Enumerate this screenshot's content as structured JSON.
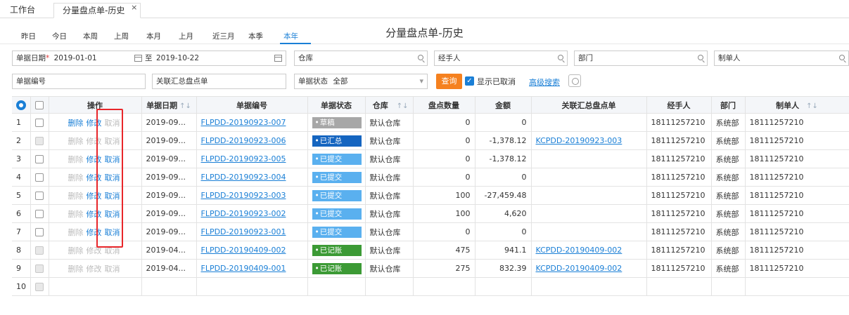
{
  "tabs": {
    "home": "工作台",
    "active": "分量盘点单-历史",
    "close": "×"
  },
  "page_title": "分量盘点单-历史",
  "periods": [
    "昨日",
    "今日",
    "本周",
    "上周",
    "本月",
    "上月",
    "近三月",
    "本季",
    "本年"
  ],
  "active_period": "本年",
  "filters": {
    "date_label": "单据日期",
    "date_required": "*",
    "date_from": "2019-01-01",
    "date_sep": "至",
    "date_to": "2019-10-22",
    "warehouse": "仓库",
    "handler": "经手人",
    "dept": "部门",
    "creator": "制单人",
    "doc_no": "单据编号",
    "linked": "关联汇总盘点单",
    "status_label": "单据状态",
    "status_value": "全部",
    "dropdown_arrow": "▾",
    "query": "查询",
    "show_cancelled": "显示已取消",
    "show_cancelled_check": "✓",
    "advanced": "高级搜索"
  },
  "table": {
    "headers": {
      "op": "操作",
      "date": "单据日期",
      "no": "单据编号",
      "status": "单据状态",
      "wh": "仓库",
      "qty": "盘点数量",
      "amt": "金额",
      "linked": "关联汇总盘点单",
      "handler": "经手人",
      "dept": "部门",
      "creator": "制单人"
    },
    "sort_icon": "↑↓",
    "op_labels": {
      "del": "删除",
      "edit": "修改",
      "cancel": "取消"
    },
    "rows": [
      {
        "idx": "1",
        "del_on": true,
        "edit_on": true,
        "cancel_on": false,
        "date": "2019-09...",
        "no": "FLPDD-20190923-007",
        "status": "草稿",
        "status_cls": "s-draft",
        "wh": "默认仓库",
        "qty": "0",
        "amt": "0",
        "linked": "",
        "handler": "18111257210",
        "dept": "系统部",
        "creator": "18111257210"
      },
      {
        "idx": "2",
        "del_on": false,
        "edit_on": false,
        "cancel_on": false,
        "date": "2019-09...",
        "no": "FLPDD-20190923-006",
        "status": "已汇总",
        "status_cls": "s-sum",
        "wh": "默认仓库",
        "qty": "0",
        "amt": "-1,378.12",
        "linked": "KCPDD-20190923-003",
        "handler": "18111257210",
        "dept": "系统部",
        "creator": "18111257210"
      },
      {
        "idx": "3",
        "del_on": false,
        "edit_on": true,
        "cancel_on": true,
        "date": "2019-09...",
        "no": "FLPDD-20190923-005",
        "status": "已提交",
        "status_cls": "s-sub",
        "wh": "默认仓库",
        "qty": "0",
        "amt": "-1,378.12",
        "linked": "",
        "handler": "18111257210",
        "dept": "系统部",
        "creator": "18111257210"
      },
      {
        "idx": "4",
        "del_on": false,
        "edit_on": true,
        "cancel_on": true,
        "date": "2019-09...",
        "no": "FLPDD-20190923-004",
        "status": "已提交",
        "status_cls": "s-sub",
        "wh": "默认仓库",
        "qty": "0",
        "amt": "0",
        "linked": "",
        "handler": "18111257210",
        "dept": "系统部",
        "creator": "18111257210"
      },
      {
        "idx": "5",
        "del_on": false,
        "edit_on": true,
        "cancel_on": true,
        "date": "2019-09...",
        "no": "FLPDD-20190923-003",
        "status": "已提交",
        "status_cls": "s-sub",
        "wh": "默认仓库",
        "qty": "100",
        "amt": "-27,459.48",
        "linked": "",
        "handler": "18111257210",
        "dept": "系统部",
        "creator": "18111257210"
      },
      {
        "idx": "6",
        "del_on": false,
        "edit_on": true,
        "cancel_on": true,
        "date": "2019-09...",
        "no": "FLPDD-20190923-002",
        "status": "已提交",
        "status_cls": "s-sub",
        "wh": "默认仓库",
        "qty": "100",
        "amt": "4,620",
        "linked": "",
        "handler": "18111257210",
        "dept": "系统部",
        "creator": "18111257210"
      },
      {
        "idx": "7",
        "del_on": false,
        "edit_on": true,
        "cancel_on": true,
        "date": "2019-09...",
        "no": "FLPDD-20190923-001",
        "status": "已提交",
        "status_cls": "s-sub",
        "wh": "默认仓库",
        "qty": "0",
        "amt": "0",
        "linked": "",
        "handler": "18111257210",
        "dept": "系统部",
        "creator": "18111257210"
      },
      {
        "idx": "8",
        "del_on": false,
        "edit_on": false,
        "cancel_on": false,
        "date": "2019-04...",
        "no": "FLPDD-20190409-002",
        "status": "已记账",
        "status_cls": "s-acc",
        "wh": "默认仓库",
        "qty": "475",
        "amt": "941.1",
        "linked": "KCPDD-20190409-002",
        "handler": "18111257210",
        "dept": "系统部",
        "creator": "18111257210"
      },
      {
        "idx": "9",
        "del_on": false,
        "edit_on": false,
        "cancel_on": false,
        "date": "2019-04...",
        "no": "FLPDD-20190409-001",
        "status": "已记账",
        "status_cls": "s-acc",
        "wh": "默认仓库",
        "qty": "275",
        "amt": "832.39",
        "linked": "KCPDD-20190409-002",
        "handler": "18111257210",
        "dept": "系统部",
        "creator": "18111257210"
      },
      {
        "idx": "10",
        "empty": true
      }
    ]
  },
  "colors": {
    "accent": "#1a7fd6",
    "query": "#f5811f",
    "highlight": "#e8262a"
  }
}
